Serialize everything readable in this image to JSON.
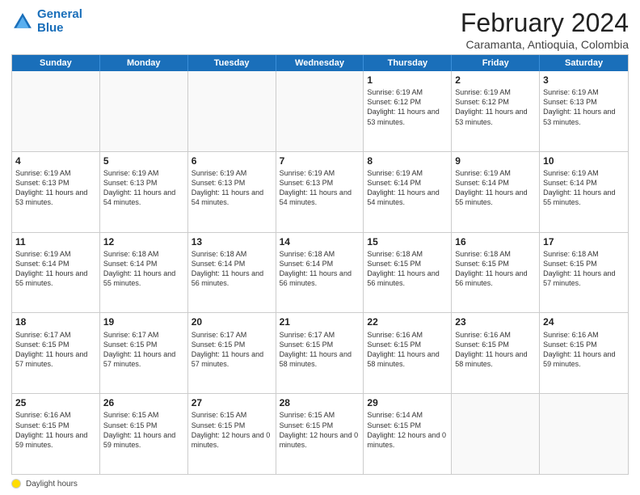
{
  "logo": {
    "line1": "General",
    "line2": "Blue"
  },
  "header": {
    "title": "February 2024",
    "subtitle": "Caramanta, Antioquia, Colombia"
  },
  "weekdays": [
    "Sunday",
    "Monday",
    "Tuesday",
    "Wednesday",
    "Thursday",
    "Friday",
    "Saturday"
  ],
  "rows": [
    [
      {
        "day": "",
        "info": ""
      },
      {
        "day": "",
        "info": ""
      },
      {
        "day": "",
        "info": ""
      },
      {
        "day": "",
        "info": ""
      },
      {
        "day": "1",
        "info": "Sunrise: 6:19 AM\nSunset: 6:12 PM\nDaylight: 11 hours and 53 minutes."
      },
      {
        "day": "2",
        "info": "Sunrise: 6:19 AM\nSunset: 6:12 PM\nDaylight: 11 hours and 53 minutes."
      },
      {
        "day": "3",
        "info": "Sunrise: 6:19 AM\nSunset: 6:13 PM\nDaylight: 11 hours and 53 minutes."
      }
    ],
    [
      {
        "day": "4",
        "info": "Sunrise: 6:19 AM\nSunset: 6:13 PM\nDaylight: 11 hours and 53 minutes."
      },
      {
        "day": "5",
        "info": "Sunrise: 6:19 AM\nSunset: 6:13 PM\nDaylight: 11 hours and 54 minutes."
      },
      {
        "day": "6",
        "info": "Sunrise: 6:19 AM\nSunset: 6:13 PM\nDaylight: 11 hours and 54 minutes."
      },
      {
        "day": "7",
        "info": "Sunrise: 6:19 AM\nSunset: 6:13 PM\nDaylight: 11 hours and 54 minutes."
      },
      {
        "day": "8",
        "info": "Sunrise: 6:19 AM\nSunset: 6:14 PM\nDaylight: 11 hours and 54 minutes."
      },
      {
        "day": "9",
        "info": "Sunrise: 6:19 AM\nSunset: 6:14 PM\nDaylight: 11 hours and 55 minutes."
      },
      {
        "day": "10",
        "info": "Sunrise: 6:19 AM\nSunset: 6:14 PM\nDaylight: 11 hours and 55 minutes."
      }
    ],
    [
      {
        "day": "11",
        "info": "Sunrise: 6:19 AM\nSunset: 6:14 PM\nDaylight: 11 hours and 55 minutes."
      },
      {
        "day": "12",
        "info": "Sunrise: 6:18 AM\nSunset: 6:14 PM\nDaylight: 11 hours and 55 minutes."
      },
      {
        "day": "13",
        "info": "Sunrise: 6:18 AM\nSunset: 6:14 PM\nDaylight: 11 hours and 56 minutes."
      },
      {
        "day": "14",
        "info": "Sunrise: 6:18 AM\nSunset: 6:14 PM\nDaylight: 11 hours and 56 minutes."
      },
      {
        "day": "15",
        "info": "Sunrise: 6:18 AM\nSunset: 6:15 PM\nDaylight: 11 hours and 56 minutes."
      },
      {
        "day": "16",
        "info": "Sunrise: 6:18 AM\nSunset: 6:15 PM\nDaylight: 11 hours and 56 minutes."
      },
      {
        "day": "17",
        "info": "Sunrise: 6:18 AM\nSunset: 6:15 PM\nDaylight: 11 hours and 57 minutes."
      }
    ],
    [
      {
        "day": "18",
        "info": "Sunrise: 6:17 AM\nSunset: 6:15 PM\nDaylight: 11 hours and 57 minutes."
      },
      {
        "day": "19",
        "info": "Sunrise: 6:17 AM\nSunset: 6:15 PM\nDaylight: 11 hours and 57 minutes."
      },
      {
        "day": "20",
        "info": "Sunrise: 6:17 AM\nSunset: 6:15 PM\nDaylight: 11 hours and 57 minutes."
      },
      {
        "day": "21",
        "info": "Sunrise: 6:17 AM\nSunset: 6:15 PM\nDaylight: 11 hours and 58 minutes."
      },
      {
        "day": "22",
        "info": "Sunrise: 6:16 AM\nSunset: 6:15 PM\nDaylight: 11 hours and 58 minutes."
      },
      {
        "day": "23",
        "info": "Sunrise: 6:16 AM\nSunset: 6:15 PM\nDaylight: 11 hours and 58 minutes."
      },
      {
        "day": "24",
        "info": "Sunrise: 6:16 AM\nSunset: 6:15 PM\nDaylight: 11 hours and 59 minutes."
      }
    ],
    [
      {
        "day": "25",
        "info": "Sunrise: 6:16 AM\nSunset: 6:15 PM\nDaylight: 11 hours and 59 minutes."
      },
      {
        "day": "26",
        "info": "Sunrise: 6:15 AM\nSunset: 6:15 PM\nDaylight: 11 hours and 59 minutes."
      },
      {
        "day": "27",
        "info": "Sunrise: 6:15 AM\nSunset: 6:15 PM\nDaylight: 12 hours and 0 minutes."
      },
      {
        "day": "28",
        "info": "Sunrise: 6:15 AM\nSunset: 6:15 PM\nDaylight: 12 hours and 0 minutes."
      },
      {
        "day": "29",
        "info": "Sunrise: 6:14 AM\nSunset: 6:15 PM\nDaylight: 12 hours and 0 minutes."
      },
      {
        "day": "",
        "info": ""
      },
      {
        "day": "",
        "info": ""
      }
    ]
  ],
  "legend": {
    "label": "Daylight hours"
  }
}
